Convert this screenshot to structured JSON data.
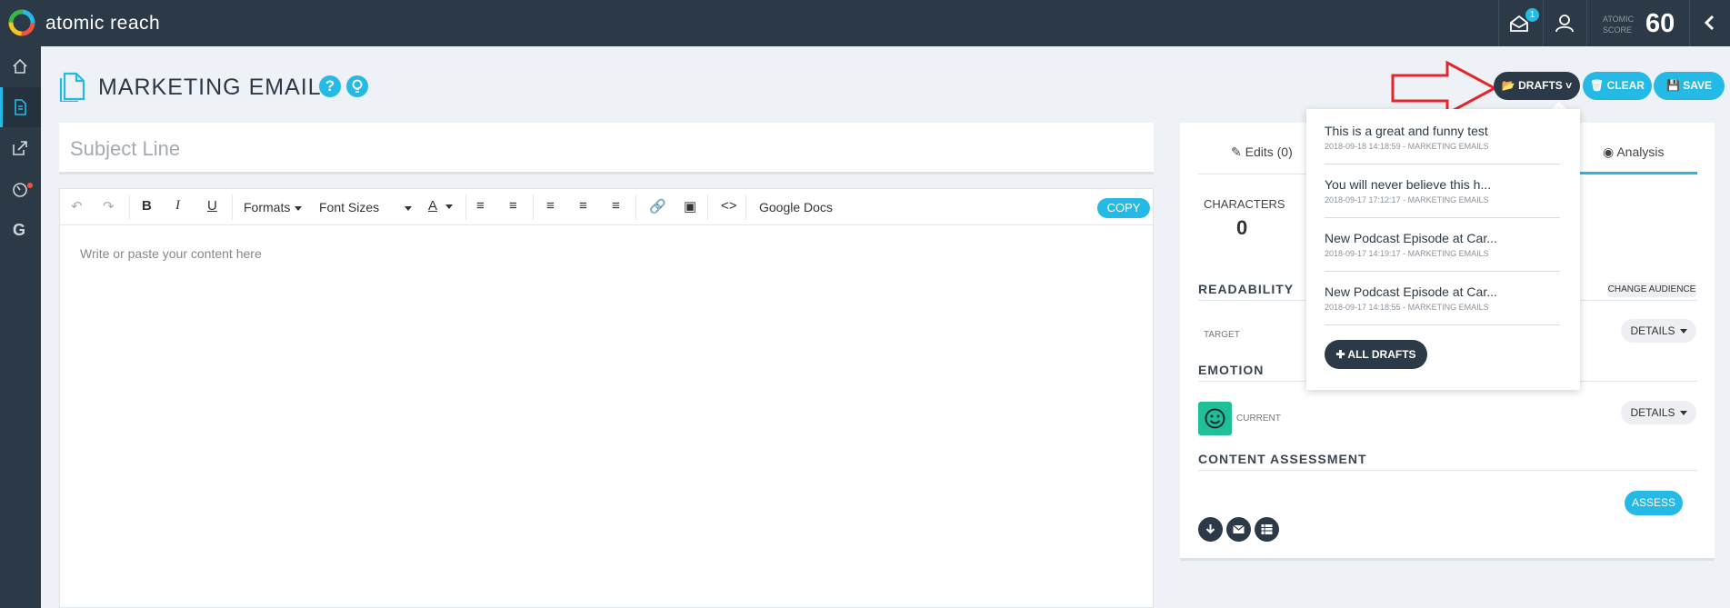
{
  "app": {
    "brand": "atomic reach",
    "notification_count": "1",
    "score_label_line1": "ATOMIC",
    "score_label_line2": "SCORE",
    "score_value": "60"
  },
  "sidebar": {
    "items": [
      {
        "icon": "home-icon"
      },
      {
        "icon": "document-icon",
        "active": true
      },
      {
        "icon": "share-icon"
      },
      {
        "icon": "dashboard-icon"
      },
      {
        "icon": "google-icon",
        "label": "G"
      }
    ]
  },
  "header": {
    "title": "MARKETING EMAILS",
    "help": "?",
    "buttons": {
      "drafts": "DRAFTS",
      "clear": "CLEAR",
      "save": "SAVE"
    }
  },
  "editor": {
    "subject_placeholder": "Subject Line",
    "toolbar": {
      "formats": "Formats",
      "font_sizes": "Font Sizes",
      "google_docs": "Google Docs",
      "copy": "COPY"
    },
    "content_placeholder": "Write or paste your content here"
  },
  "panel": {
    "tabs": {
      "edits": "Edits (0)",
      "analysis": "Analysis"
    },
    "characters_label": "CHARACTERS",
    "characters_value": "0",
    "readability": {
      "heading": "READABILITY",
      "change_audience": "CHANGE AUDIENCE",
      "target_label": "TARGET",
      "details": "DETAILS"
    },
    "emotion": {
      "heading": "EMOTION",
      "current_label": "CURRENT",
      "details": "DETAILS"
    },
    "content_assessment": {
      "heading": "CONTENT ASSESSMENT",
      "assess": "ASSESS"
    }
  },
  "drafts_dropdown": {
    "items": [
      {
        "title": "This is a great and funny test",
        "meta": "2018-09-18 14:18:59 - MARKETING EMAILS"
      },
      {
        "title": "You will never believe this h...",
        "meta": "2018-09-17 17:12:17 - MARKETING EMAILS"
      },
      {
        "title": "New Podcast Episode at Car...",
        "meta": "2018-09-17 14:19:17 - MARKETING EMAILS"
      },
      {
        "title": "New Podcast Episode at Car...",
        "meta": "2018-09-17 14:18:55 - MARKETING EMAILS"
      }
    ],
    "all_drafts": "ALL DRAFTS"
  },
  "colors": {
    "navy": "#2c3a47",
    "accent": "#25b9e6",
    "annotation_arrow": "#e3262d",
    "emotion": "#1fbf98"
  }
}
